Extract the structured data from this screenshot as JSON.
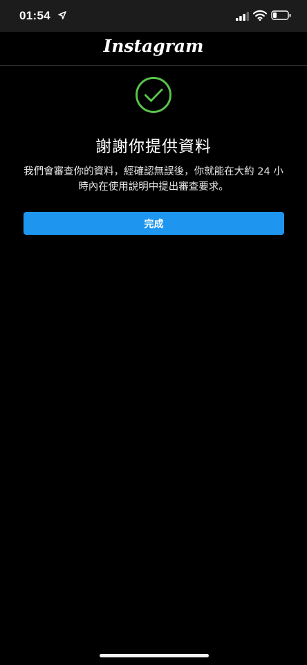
{
  "status_bar": {
    "time": "01:54",
    "location_icon": "location-arrow-icon",
    "signal_icon": "cellular-signal-icon",
    "wifi_icon": "wifi-icon",
    "battery_icon": "battery-icon",
    "battery_level": 0.25
  },
  "header": {
    "logo_text": "Instagram"
  },
  "content": {
    "check_icon": "check-circle-icon",
    "title": "謝謝你提供資料",
    "message": "我們會審查你的資料，經確認無誤後，你就能在大約 24 小時內在使用說明中提出審查要求。",
    "done_label": "完成"
  },
  "colors": {
    "background": "#000000",
    "accent": "#1e96f0",
    "success": "#5ac44c"
  }
}
